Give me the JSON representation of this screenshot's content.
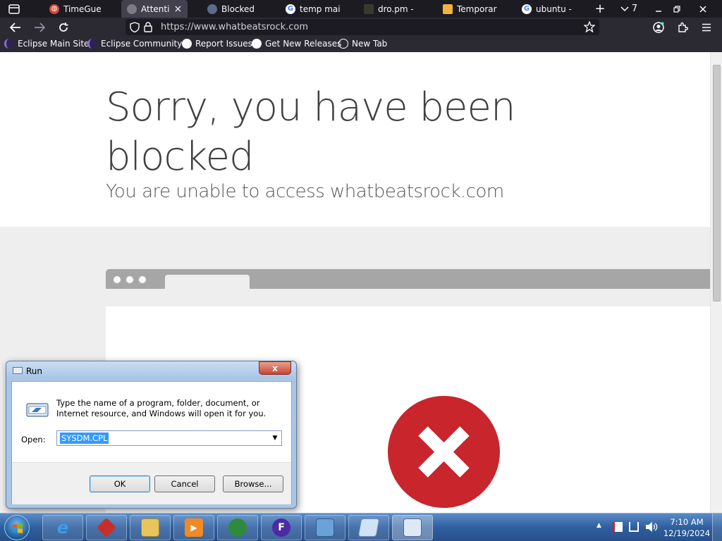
{
  "browser": {
    "tabs": [
      {
        "title": "TimeGues",
        "icon": "globe-icon",
        "active": false
      },
      {
        "title": "Attenti",
        "icon": "globe-icon",
        "active": true
      },
      {
        "title": "Blocked",
        "icon": "globe-icon",
        "active": false
      },
      {
        "title": "temp mai",
        "icon": "google-icon",
        "active": false
      },
      {
        "title": "dro.pm -",
        "icon": "site-icon",
        "active": false
      },
      {
        "title": "Temporar",
        "icon": "folder-icon",
        "active": false
      },
      {
        "title": "ubuntu -",
        "icon": "google-icon",
        "active": false
      }
    ],
    "active_tab_close": "×",
    "new_tab_glyph": "+",
    "tab_count": "7",
    "url": "https://www.whatbeatsrock.com",
    "bookmarks": [
      {
        "label": "Eclipse Main Site",
        "icon": "eclipse-icon"
      },
      {
        "label": "Eclipse Community",
        "icon": "eclipse-icon"
      },
      {
        "label": "Report Issues",
        "icon": "github-icon"
      },
      {
        "label": "Get New Releases",
        "icon": "github-icon"
      },
      {
        "label": "New Tab",
        "icon": "globe-icon"
      }
    ]
  },
  "page": {
    "title": "Sorry, you have been blocked",
    "subtitle": "You are unable to access whatbeatsrock.com"
  },
  "run_dialog": {
    "title": "Run",
    "close_glyph": "x",
    "message": "Type the name of a program, folder, document, or Internet resource, and Windows will open it for you.",
    "open_label": "Open:",
    "open_value": "SYSDM.CPL",
    "ok_label": "OK",
    "cancel_label": "Cancel",
    "browse_label": "Browse..."
  },
  "taskbar": {
    "clock_time": "7:10 AM",
    "clock_date": "12/19/2024",
    "tray_arrow": "▲"
  },
  "colors": {
    "error_red": "#c8252c",
    "browser_dark": "#1c1b22",
    "taskbar_blue": "#2f5f9e"
  }
}
